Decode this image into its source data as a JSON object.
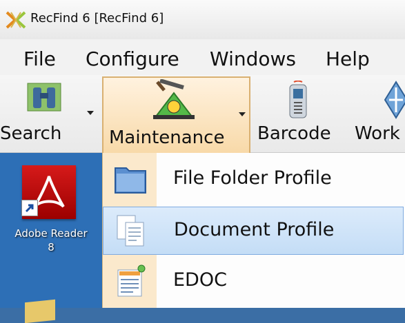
{
  "window": {
    "title": "RecFind 6 [RecFind 6]"
  },
  "menubar": {
    "items": [
      "File",
      "Configure",
      "Windows",
      "Help"
    ]
  },
  "toolbar": {
    "search_label": "Search",
    "maintenance_label": "Maintenance",
    "barcode_label": "Barcode",
    "work_label": "Work"
  },
  "desktop": {
    "adobe_label_line1": "Adobe Reader",
    "adobe_label_line2": "8"
  },
  "dropdown": {
    "items": [
      {
        "label": "File Folder Profile",
        "icon": "folder-icon"
      },
      {
        "label": "Document Profile",
        "icon": "document-icon"
      },
      {
        "label": "EDOC",
        "icon": "edoc-icon"
      }
    ],
    "hovered_item": "Document Profile"
  },
  "colors": {
    "menu_highlight": "#c4ddf6",
    "toolbar_active": "#f8d9a8",
    "desktop_blue": "#2d6fb6"
  }
}
